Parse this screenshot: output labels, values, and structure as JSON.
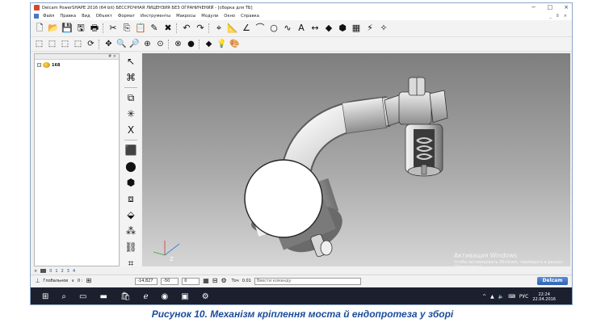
{
  "window": {
    "title": "Delcam PowerSHAPE 2016 (64 bit) БЕССРОЧНАЯ ЛИЦЕНЗИЯ БЕЗ ОГРАНИЧЕНИЙ - [сборка для ТБ]",
    "controls": [
      "−",
      "□",
      "×"
    ],
    "child_controls": [
      "_",
      "ð",
      "×"
    ]
  },
  "menu": {
    "items": [
      "Файл",
      "Правка",
      "Вид",
      "Объект",
      "Формат",
      "Инструменты",
      "Макросы",
      "Модули",
      "Окно",
      "Справка"
    ]
  },
  "toolbar1": {
    "icons": [
      {
        "name": "new-file-icon",
        "glyph": "🗋"
      },
      {
        "name": "open-folder-icon",
        "glyph": "📂"
      },
      {
        "name": "save-disk-icon",
        "glyph": "💾"
      },
      {
        "name": "save-all-icon",
        "glyph": "🖫"
      },
      {
        "name": "print-icon",
        "glyph": "🖶"
      },
      {
        "name": "cut-icon",
        "glyph": "✂"
      },
      {
        "name": "copy-icon",
        "glyph": "⎘"
      },
      {
        "name": "paste-icon",
        "glyph": "📋"
      },
      {
        "name": "edit-icon",
        "glyph": "✎"
      },
      {
        "name": "delete-icon",
        "glyph": "✖"
      },
      {
        "name": "undo-icon",
        "glyph": "↶"
      },
      {
        "name": "redo-icon",
        "glyph": "↷"
      },
      {
        "name": "workplane-icon",
        "glyph": "⌖"
      },
      {
        "name": "measure-icon",
        "glyph": "📐"
      },
      {
        "name": "line-icon",
        "glyph": "∠"
      },
      {
        "name": "arc-icon",
        "glyph": "⌒"
      },
      {
        "name": "circle-icon",
        "glyph": "○"
      },
      {
        "name": "curve-icon",
        "glyph": "∿"
      },
      {
        "name": "text-icon",
        "glyph": "A"
      },
      {
        "name": "dimension-icon",
        "glyph": "↔"
      },
      {
        "name": "surface-icon",
        "glyph": "◆"
      },
      {
        "name": "solid-icon",
        "glyph": "⬢"
      },
      {
        "name": "mesh-icon",
        "glyph": "▦"
      },
      {
        "name": "electrode-icon",
        "glyph": "⚡"
      },
      {
        "name": "wand-icon",
        "glyph": "✧"
      }
    ]
  },
  "toolbar2": {
    "icons": [
      {
        "name": "view-iso-1-icon",
        "glyph": "⬚"
      },
      {
        "name": "view-iso-2-icon",
        "glyph": "⬚"
      },
      {
        "name": "view-iso-3-icon",
        "glyph": "⬚"
      },
      {
        "name": "view-iso-4-icon",
        "glyph": "⬚"
      },
      {
        "name": "rotate-view-icon",
        "glyph": "⟳"
      },
      {
        "name": "pan-view-icon",
        "glyph": "✥"
      },
      {
        "name": "zoom-in-icon",
        "glyph": "🔍"
      },
      {
        "name": "zoom-box-icon",
        "glyph": "🔎"
      },
      {
        "name": "zoom-fit-icon",
        "glyph": "⊕"
      },
      {
        "name": "zoom-select-icon",
        "glyph": "⊙"
      },
      {
        "name": "wireframe-icon",
        "glyph": "⊗"
      },
      {
        "name": "shaded-icon",
        "glyph": "●"
      },
      {
        "name": "shaded-wire-icon",
        "glyph": "◆"
      },
      {
        "name": "light-icon",
        "glyph": "💡"
      },
      {
        "name": "material-icon",
        "glyph": "🎨"
      }
    ]
  },
  "tree": {
    "header_glyph": "# ×",
    "expander": "−",
    "root_label": "168"
  },
  "vtoolbar": {
    "icons": [
      {
        "name": "select-arrow-icon",
        "glyph": "↖"
      },
      {
        "name": "select-mode-icon",
        "glyph": "⌘"
      },
      {
        "name": "group-icon",
        "glyph": "⧉"
      },
      {
        "name": "point-icon",
        "glyph": "✳"
      },
      {
        "name": "x-axis-icon",
        "glyph": "X"
      },
      {
        "name": "solid-box-icon",
        "glyph": "⬛"
      },
      {
        "name": "solid-cylinder-icon",
        "glyph": "⬤"
      },
      {
        "name": "solid-feature-icon",
        "glyph": "⬢"
      },
      {
        "name": "solid-boolean-icon",
        "glyph": "⧈"
      },
      {
        "name": "solid-extrude-icon",
        "glyph": "⬙"
      },
      {
        "name": "solid-array-icon",
        "glyph": "⁂"
      },
      {
        "name": "assembly-icon",
        "glyph": "⛓"
      },
      {
        "name": "component-icon",
        "glyph": "⌗"
      }
    ]
  },
  "viewport": {
    "axis_label": "Z",
    "activation_title": "Активация Windows",
    "activation_hint": "Чтобы активировать Windows, перейдите в раздел \"Параметры\"."
  },
  "layers": {
    "close": "×",
    "tabs": [
      "0",
      "1",
      "2",
      "3",
      "4"
    ]
  },
  "status": {
    "mode_label": "Глобальное",
    "mode_arrow": "∨",
    "snap_label": "0 :",
    "x": "-14,827",
    "y": "-50",
    "z": "0",
    "tol_label": "Точ",
    "tol_value": "0.01",
    "command_placeholder": "Ввести команду",
    "logo": "Delcam"
  },
  "taskbar": {
    "tray_lang": "РУС",
    "time": "22:24",
    "date": "22.04.2016"
  },
  "caption": "Рисунок 10. Механізм кріплення моста й ендопротеза у зборі"
}
